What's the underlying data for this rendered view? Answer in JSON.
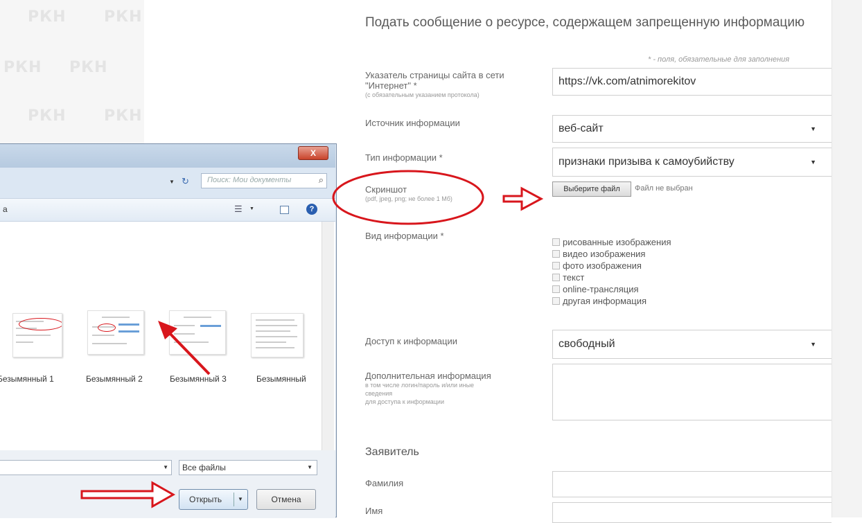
{
  "watermark": {
    "text": "РКН"
  },
  "form": {
    "title": "Подать сообщение о ресурсе, содержащем запрещенную информацию",
    "required_note": "* - поля, обязательные для заполнения",
    "url_label": "Указатель страницы сайта в сети \"Интернет\" *",
    "url_hint": "(с обязательным указанием протокола)",
    "url_value": "https://vk.com/atnimorekitov",
    "source_label": "Источник информации",
    "source_value": "веб-сайт",
    "type_label": "Тип информации *",
    "type_value": "признаки призыва к самоубийству",
    "screenshot_label": "Скриншот",
    "screenshot_hint": "(pdf, jpeg, png; не более 1 Мб)",
    "choose_file": "Выберите файл",
    "no_file": "Файл не выбран",
    "kind_label": "Вид информации *",
    "kind_options": [
      "рисованные изображения",
      "видео изображения",
      "фото изображения",
      "текст",
      "online-трансляция",
      "другая информация"
    ],
    "access_label": "Доступ к информации",
    "access_value": "свободный",
    "extra_label": "Дополнительная информация",
    "extra_hint1": "в том числе логин/пароль и/или иные",
    "extra_hint2": "сведения",
    "extra_hint3": "для доступа к информации",
    "applicant_heading": "Заявитель",
    "last_name_label": "Фамилия",
    "first_name_label": "Имя"
  },
  "dialog": {
    "close": "X",
    "search_placeholder": "Поиск: Мои документы",
    "organize_fragment": "а",
    "help": "?",
    "files": [
      "Безымянный 1",
      "Безымянный 2",
      "Безымянный 3",
      "Безымянный"
    ],
    "file_type": "Все файлы",
    "open_button": "Открыть",
    "cancel_button": "Отмена"
  },
  "colors": {
    "annotation": "#d8161c",
    "dialog_frame": "#b6cae0"
  }
}
